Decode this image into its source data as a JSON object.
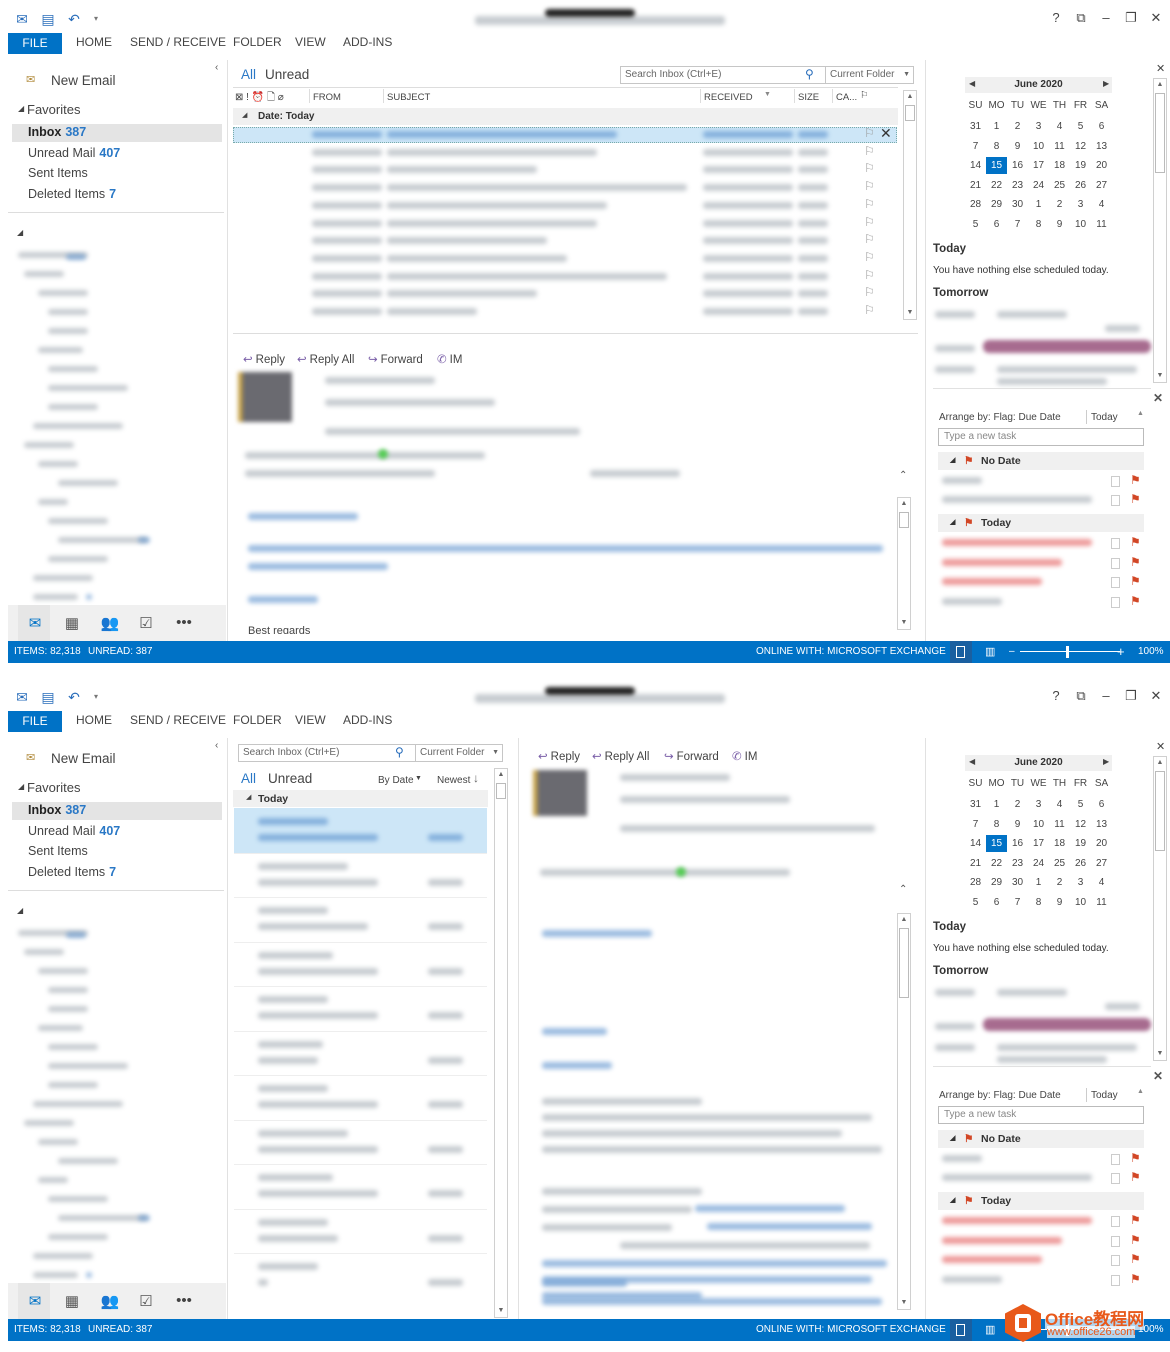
{
  "titlebar": {
    "icons": [
      "outlook-icon",
      "send-receive-icon",
      "undo-icon",
      "customize-icon"
    ],
    "controls": [
      "?",
      "⧉",
      "–",
      "❐",
      "✕"
    ]
  },
  "ribbon": {
    "tabs": [
      "FILE",
      "HOME",
      "SEND / RECEIVE",
      "FOLDER",
      "VIEW",
      "ADD-INS"
    ]
  },
  "nav": {
    "new_email": "New Email",
    "favorites": "Favorites",
    "items": [
      {
        "label": "Inbox",
        "count": "387"
      },
      {
        "label": "Unread Mail",
        "count": "407"
      },
      {
        "label": "Sent Items",
        "count": ""
      },
      {
        "label": "Deleted Items",
        "count": "7"
      }
    ]
  },
  "list": {
    "filter_all": "All",
    "filter_unread": "Unread",
    "search_placeholder": "Search Inbox (Ctrl+E)",
    "scope": "Current Folder",
    "columns": [
      "FROM",
      "SUBJECT",
      "RECEIVED",
      "SIZE",
      "CA..."
    ],
    "group": "Date: Today",
    "group_short": "Today",
    "sort_by": "By Date",
    "sort_order": "Newest"
  },
  "reading": {
    "reply": "Reply",
    "reply_all": "Reply All",
    "forward": "Forward",
    "im": "IM",
    "closing_visible": "Best regards"
  },
  "calendar": {
    "month": "June 2020",
    "weekdays": [
      "SU",
      "MO",
      "TU",
      "WE",
      "TH",
      "FR",
      "SA"
    ],
    "weeks": [
      [
        "31",
        "1",
        "2",
        "3",
        "4",
        "5",
        "6"
      ],
      [
        "7",
        "8",
        "9",
        "10",
        "11",
        "12",
        "13"
      ],
      [
        "14",
        "15",
        "16",
        "17",
        "18",
        "19",
        "20"
      ],
      [
        "21",
        "22",
        "23",
        "24",
        "25",
        "26",
        "27"
      ],
      [
        "28",
        "29",
        "30",
        "1",
        "2",
        "3",
        "4"
      ],
      [
        "5",
        "6",
        "7",
        "8",
        "9",
        "10",
        "11"
      ]
    ],
    "selected": "15",
    "today_heading": "Today",
    "today_text": "You have nothing else scheduled today.",
    "tomorrow_heading": "Tomorrow"
  },
  "tasks": {
    "arrange": "Arrange by: Flag: Due Date",
    "arrange_value": "Today",
    "new_task_placeholder": "Type a new task",
    "groups": [
      "No Date",
      "Today"
    ]
  },
  "status": {
    "items": "ITEMS: 82,318",
    "unread": "UNREAD: 387",
    "connection": "ONLINE WITH: MICROSOFT EXCHANGE",
    "zoom": "100%"
  },
  "colors": {
    "accent": "#0072c6",
    "flag": "#d24726",
    "selected_row": "#cde6f7"
  },
  "watermark": {
    "brand": "Office教程网",
    "url": "www.office26.com"
  }
}
